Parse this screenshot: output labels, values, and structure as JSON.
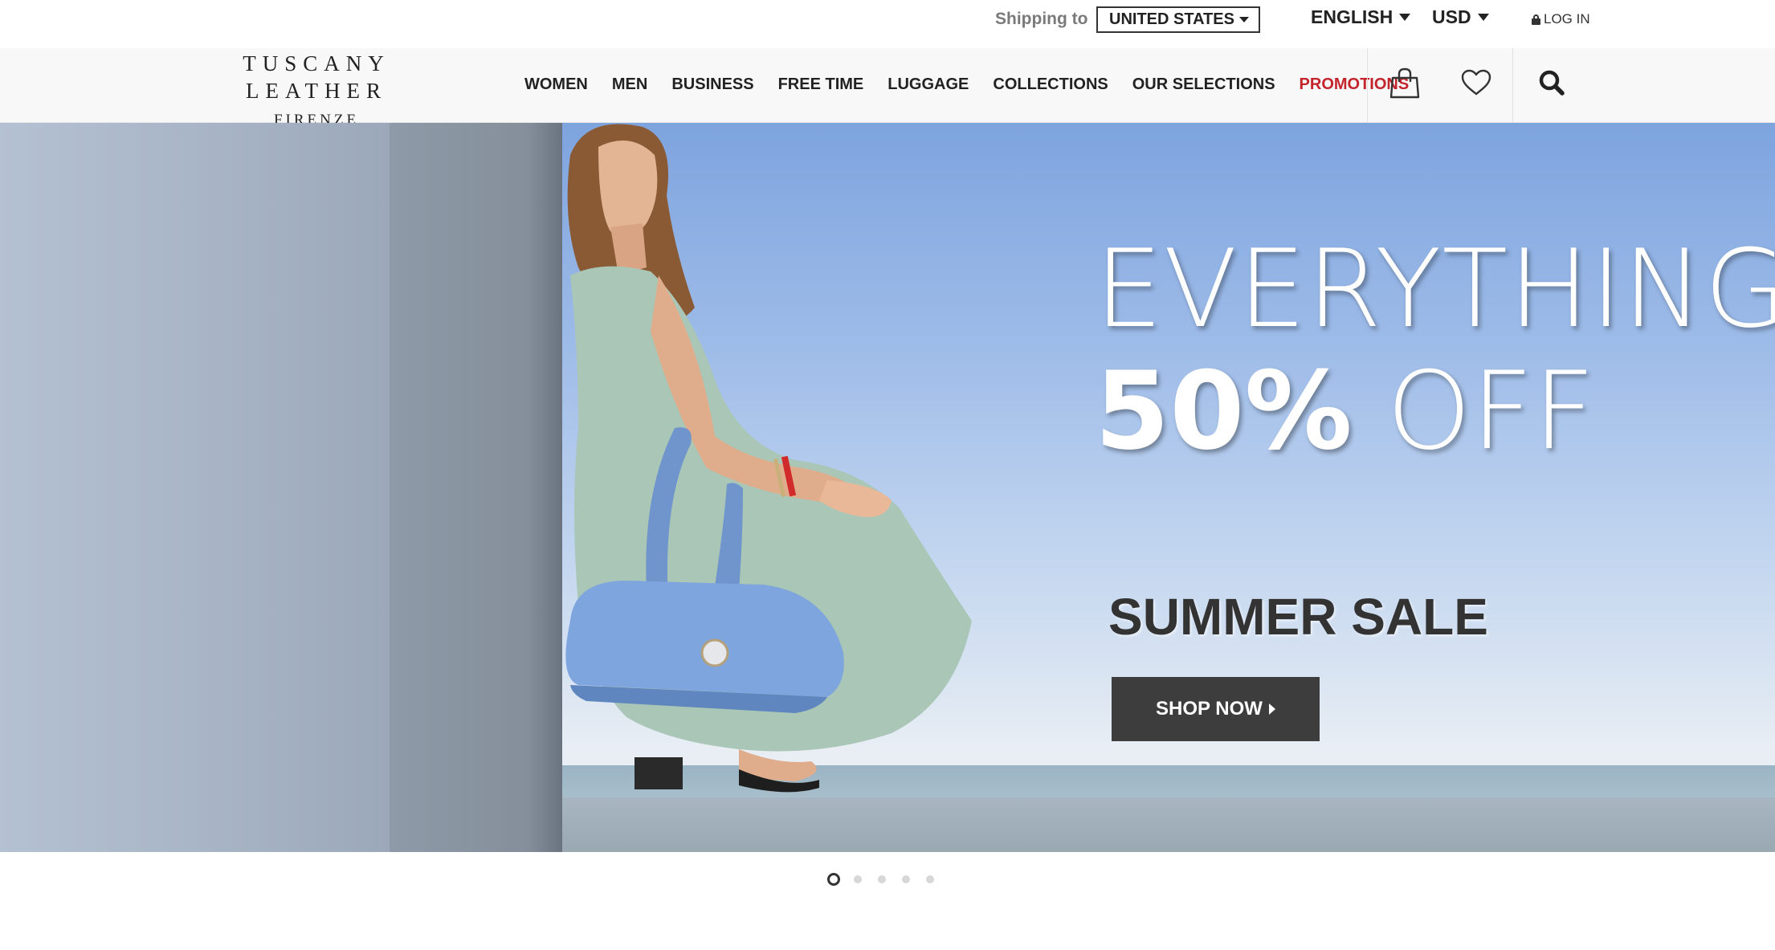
{
  "topbar": {
    "shipping_label": "Shipping to",
    "country": "UNITED STATES",
    "language": "ENGLISH",
    "currency": "USD",
    "login": "LOG IN"
  },
  "brand": {
    "name": "TUSCANY LEATHER",
    "city": "FIRENZE"
  },
  "nav": {
    "items": [
      {
        "label": "WOMEN"
      },
      {
        "label": "MEN"
      },
      {
        "label": "BUSINESS"
      },
      {
        "label": "FREE TIME"
      },
      {
        "label": "LUGGAGE"
      },
      {
        "label": "COLLECTIONS"
      },
      {
        "label": "OUR SELECTIONS"
      },
      {
        "label": "PROMOTIONS"
      }
    ]
  },
  "hero": {
    "line1": "EVERYTHING",
    "line2_bold": "50%",
    "line2_light": "OFF",
    "line3": "SUMMER SALE",
    "cta": "SHOP NOW"
  },
  "carousel": {
    "slide_count": 5,
    "active_slide": 1
  },
  "colors": {
    "promo": "#c3242b",
    "cta_bg": "#3d3d3d",
    "text_dark": "#222222"
  }
}
